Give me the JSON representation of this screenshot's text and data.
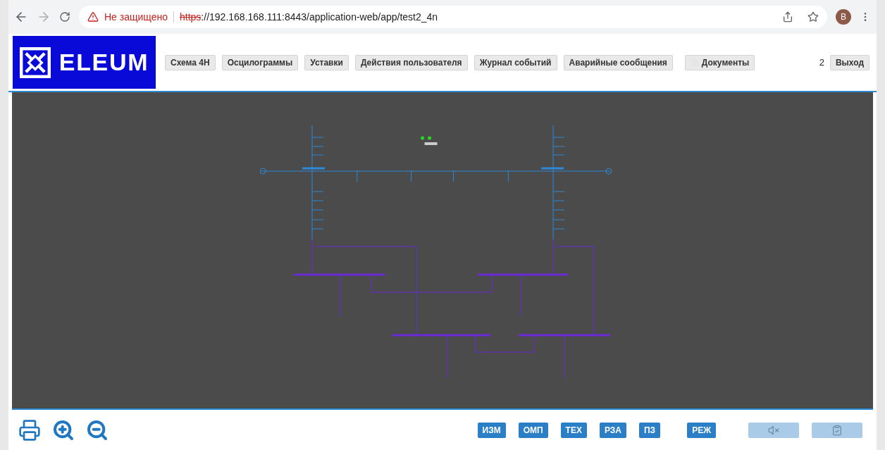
{
  "browser": {
    "security": "Не защищено",
    "url_scheme": "https",
    "url_rest": "://192.168.168.111:8443/application-web/app/test2_4n",
    "profile": "B"
  },
  "header": {
    "logo": "ELEUM",
    "nav": [
      {
        "label": "Схема 4Н",
        "icon": false
      },
      {
        "label": "Осцилограммы",
        "icon": false
      },
      {
        "label": "Уставки",
        "icon": false
      },
      {
        "label": "Действия пользователя",
        "icon": false
      },
      {
        "label": "Журнал событий",
        "icon": false
      },
      {
        "label": "Аварийные сообщения",
        "icon": false
      },
      {
        "label": "Документы",
        "icon": true
      }
    ],
    "user_count": "2",
    "exit": "Выход"
  },
  "toolbar": {
    "modes": [
      {
        "label": "ИЗМ"
      },
      {
        "label": "ОМП"
      },
      {
        "label": "ТЕХ"
      },
      {
        "label": "РЗА"
      },
      {
        "label": "ПЗ"
      },
      {
        "label": "РЕЖ"
      }
    ],
    "actions": [
      {
        "kind": "mute",
        "disabled": true
      },
      {
        "kind": "report",
        "disabled": true
      }
    ]
  }
}
